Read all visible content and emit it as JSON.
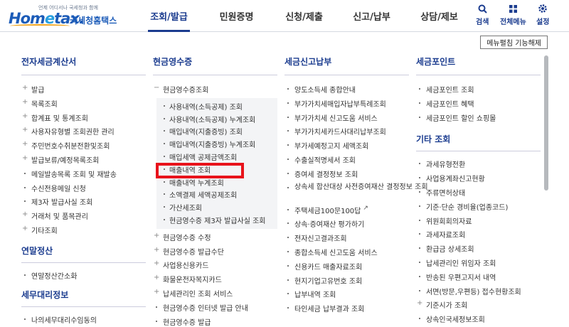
{
  "header": {
    "logo_small": "언제 어디서나 국세청과 함께",
    "logo_home": "Hom",
    "logo_e": "e",
    "logo_tax": "tax.",
    "logo_org": "국세청홈택스",
    "nav": [
      "조회/발급",
      "민원증명",
      "신청/제출",
      "신고/납부",
      "상담/제보"
    ],
    "utils": [
      {
        "icon": "search-icon",
        "label": "검색"
      },
      {
        "icon": "menu-grid-icon",
        "label": "전체메뉴"
      },
      {
        "icon": "gear-icon",
        "label": "설정"
      }
    ]
  },
  "toolbar": {
    "toggle_label": "메뉴펼침 기능해제"
  },
  "col1": {
    "title": "전자세금계산서",
    "items": [
      {
        "mark": "+",
        "label": "발급"
      },
      {
        "mark": "+",
        "label": "목록조회"
      },
      {
        "mark": "+",
        "label": "합계표 및 통계조회"
      },
      {
        "mark": "+",
        "label": "사용자유형별 조회권한 관리"
      },
      {
        "mark": "+",
        "label": "주민번호수취분전환및조회"
      },
      {
        "mark": "+",
        "label": "발급보류/예정목록조회"
      },
      {
        "mark": "dot",
        "label": "메일발송목록 조회 및 재발송"
      },
      {
        "mark": "dot",
        "label": "수신전용메일 신청"
      },
      {
        "mark": "dot",
        "label": "제3자 발급사실 조회"
      },
      {
        "mark": "+",
        "label": "거래처 및 품목관리"
      },
      {
        "mark": "+",
        "label": "기타조회"
      }
    ],
    "title2": "연말정산",
    "items2": [
      {
        "mark": "dot",
        "label": "연말정산간소화"
      }
    ],
    "title3": "세무대리정보",
    "items3": [
      {
        "mark": "dot",
        "label": "나의세무대리수임동의"
      }
    ]
  },
  "col2": {
    "title": "현금영수증",
    "open_item": {
      "mark": "−",
      "label": "현금영수증조회"
    },
    "sub_items": [
      "사용내역(소득공제) 조회",
      "사용내역(소득공제) 누계조회",
      "매입내역(지출증빙) 조회",
      "매입내역(지출증빙) 누계조회",
      "매입세액 공제금액조회",
      "매출내역 조회",
      "매출내역 누계조회",
      "소액결제 세액공제조회",
      "가산세조회",
      "현금영수증 제3자 발급사실 조회"
    ],
    "items": [
      {
        "mark": "+",
        "label": "현금영수증 수정"
      },
      {
        "mark": "+",
        "label": "현금영수증 발급수단"
      },
      {
        "mark": "+",
        "label": "사업용신용카드"
      },
      {
        "mark": "+",
        "label": "화물운전자복지카드"
      },
      {
        "mark": "+",
        "label": "납세관리인 조회 서비스"
      },
      {
        "mark": "dot",
        "label": "현금영수증 인터넷 발급 안내"
      },
      {
        "mark": "dot",
        "label": "현금영수증 발급"
      }
    ]
  },
  "col3": {
    "title": "세금신고납부",
    "items": [
      "양도소득세 종합안내",
      "부가가치세매입자납부특례조회",
      "부가가치세 신고도움 서비스",
      "부가가치세카드사대리납부조회",
      "부가세예정고지 세액조회",
      "수출실적명세서 조회",
      "증여세 결정정보 조회",
      "상속세 합산대상 사전증여재산 결정정보 조회",
      "주택세금100문100답",
      "상속·증여재산 평가하기",
      "전자신고결과조회",
      "종합소득세 신고도움 서비스",
      "신용카드 매출자료조회",
      "현지기업고유번호 조회",
      "납부내역 조회",
      "타인세금 납부결과 조회"
    ]
  },
  "col4": {
    "title": "세금포인트",
    "items": [
      "세금포인트 조회",
      "세금포인트 혜택",
      "세금포인트 할인 쇼핑몰"
    ],
    "title2": "기타 조회",
    "items2": [
      {
        "mark": "dot",
        "label": "과세유형전환"
      },
      {
        "mark": "dot",
        "label": "사업용계좌신고현황"
      },
      {
        "mark": "dot",
        "label": "주류면허상태"
      },
      {
        "mark": "dot",
        "label": "기준·단순 경비율(업종코드)"
      },
      {
        "mark": "dot",
        "label": "위원회회의자료"
      },
      {
        "mark": "dot",
        "label": "과세자료조회"
      },
      {
        "mark": "dot",
        "label": "환급금 상세조회"
      },
      {
        "mark": "dot",
        "label": "납세관리인 위임자 조회"
      },
      {
        "mark": "dot",
        "label": "반송된 우편고지서 내역"
      },
      {
        "mark": "dot",
        "label": "서면(방문,우편등) 접수현황조회"
      },
      {
        "mark": "+",
        "label": "기준시가 조회"
      },
      {
        "mark": "dot",
        "label": "상속인국세정보조회"
      }
    ]
  },
  "colors": {
    "accent": "#1b3c8f",
    "highlight": "#e8131b"
  }
}
